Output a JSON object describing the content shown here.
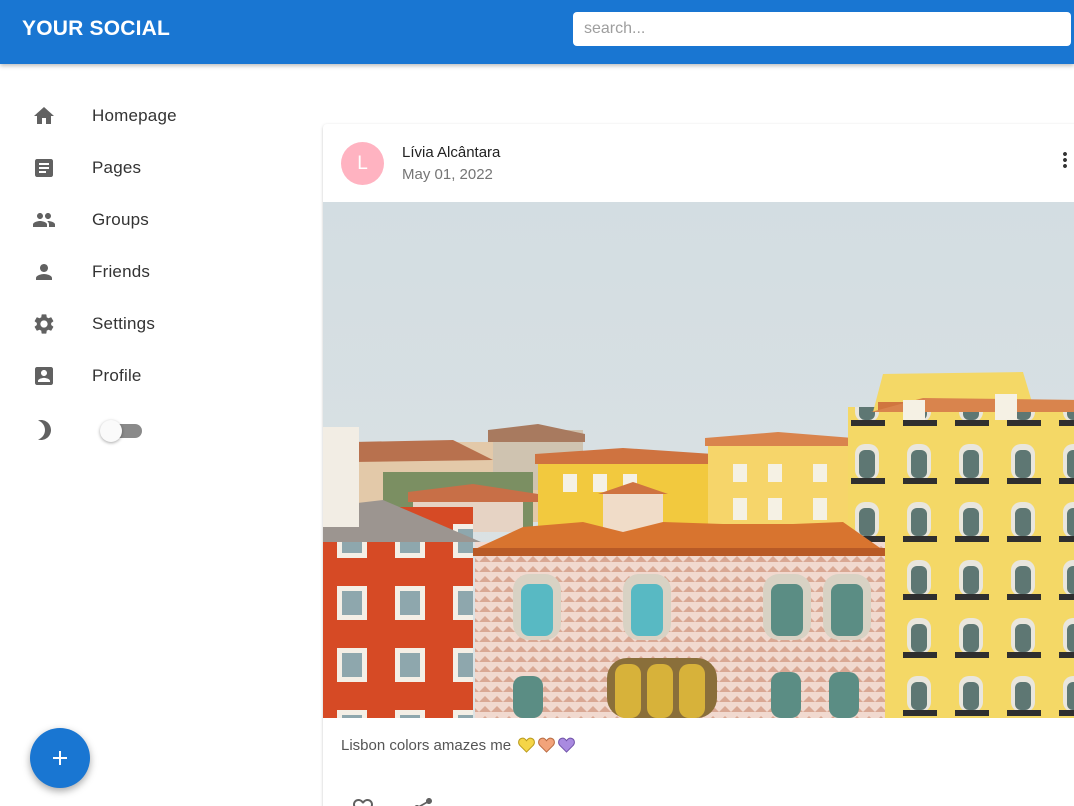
{
  "app": {
    "brand": "YOUR SOCIAL",
    "search_placeholder": "search...",
    "accent_color": "#1976d2"
  },
  "sidebar": {
    "items": [
      {
        "label": "Homepage",
        "icon": "home-icon"
      },
      {
        "label": "Pages",
        "icon": "article-icon"
      },
      {
        "label": "Groups",
        "icon": "group-icon"
      },
      {
        "label": "Friends",
        "icon": "person-icon"
      },
      {
        "label": "Settings",
        "icon": "gear-icon"
      },
      {
        "label": "Profile",
        "icon": "account-box-icon"
      }
    ],
    "dark_mode_icon": "moon-icon",
    "dark_mode_enabled": false
  },
  "fab": {
    "icon": "plus-icon"
  },
  "post": {
    "avatar_letter": "L",
    "avatar_color": "#ffb3c1",
    "author": "Lívia Alcântara",
    "date": "May 01, 2022",
    "menu_icon": "more-vert-icon",
    "image_subject": "colorful Lisbon buildings",
    "caption": "Lisbon colors amazes me",
    "caption_emojis": [
      "yellow-heart",
      "orange-heart",
      "purple-heart"
    ],
    "heart_colors": [
      "#f5d547",
      "#f2a37a",
      "#a98ae0"
    ],
    "action_icons": [
      "favorite-icon",
      "share-icon"
    ]
  }
}
